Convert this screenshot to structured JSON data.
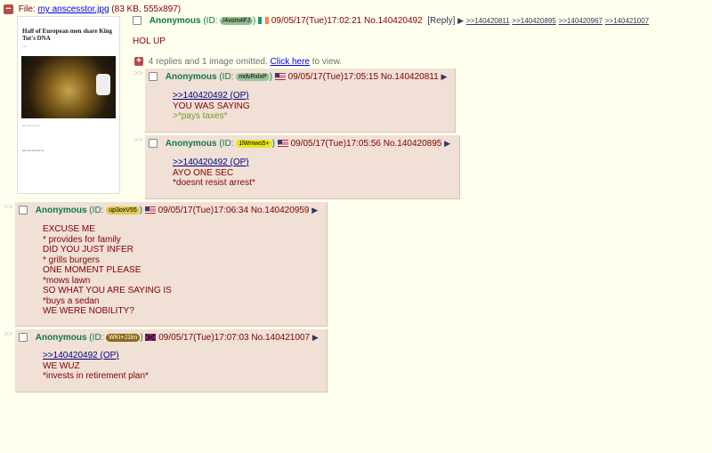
{
  "op": {
    "file_label": "File:",
    "file_name": "my anscesstor.jpg",
    "file_info": "(83 KB, 555x897)",
    "thumb_headline": "Half of European men share King Tut's DNA",
    "name": "Anonymous",
    "id_label": "(ID:",
    "id": "/4vom4FJ",
    "id_close": ")",
    "datetime": "09/05/17(Tue)17:02:21",
    "post_no": "No.140420492",
    "reply_label": "[Reply]",
    "backlinks": [
      ">>140420811",
      ">>140420895",
      ">>140420967",
      ">>140421007"
    ],
    "message": "HOL UP",
    "omitted_text": "4 replies and 1 image omitted.",
    "omitted_link": "Click here",
    "omitted_suffix": "to view."
  },
  "replies": [
    {
      "name": "Anonymous",
      "id_label": "(ID:",
      "id": "mdvRxlxP",
      "id_close": ")",
      "datetime": "09/05/17(Tue)17:05:15",
      "post_no": "No.140420811",
      "lines": [
        ">>140420492 (OP)",
        "YOU WAS SAYING",
        ">*pays taxes*"
      ]
    },
    {
      "name": "Anonymous",
      "id_label": "(ID:",
      "id": "1lWmws5+",
      "id_close": ")",
      "datetime": "09/05/17(Tue)17:05:56",
      "post_no": "No.140420895",
      "lines": [
        ">>140420492 (OP)",
        "AYO ONE SEC",
        "*doesnt resist arrest*"
      ]
    },
    {
      "name": "Anonymous",
      "id_label": "(ID:",
      "id": "up3oxV55",
      "id_close": ")",
      "datetime": "09/05/17(Tue)17:06:34",
      "post_no": "No.140420959",
      "lines": [
        "EXCUSE ME",
        "* provides for family",
        "DID YOU JUST INFER",
        "* grills burgers",
        "ONE MOMENT PLEASE",
        "*mows lawn",
        "SO WHAT YOU ARE SAYING IS",
        "*buys a sedan",
        "WE WERE NOBILITY?"
      ]
    },
    {
      "name": "Anonymous",
      "id_label": "(ID:",
      "id": "WKt+J1kn",
      "id_close": ")",
      "datetime": "09/05/17(Tue)17:07:03",
      "post_no": "No.140421007",
      "lines": [
        ">>140420492 (OP)",
        "WE WUZ",
        "*invests in retirement plan*"
      ]
    }
  ],
  "side_arrows": ">>",
  "post_arrow": "▶",
  "colors": {
    "background": "#ffffee",
    "reply_bg": "#f0e0d6",
    "name": "#117743",
    "text": "#800000",
    "quote": "#789922",
    "id_op": "#8fbf8f",
    "id_r1": "#9cc49c",
    "id_r2": "#e6e61a",
    "id_r3": "#e0c84a",
    "id_r4": "#8a6a1a"
  },
  "icons": [
    "minus-icon",
    "plus-icon",
    "checkbox-icon",
    "flag-ireland-icon",
    "flag-us-icon",
    "flag-confederate-icon",
    "arrow-right-icon"
  ]
}
